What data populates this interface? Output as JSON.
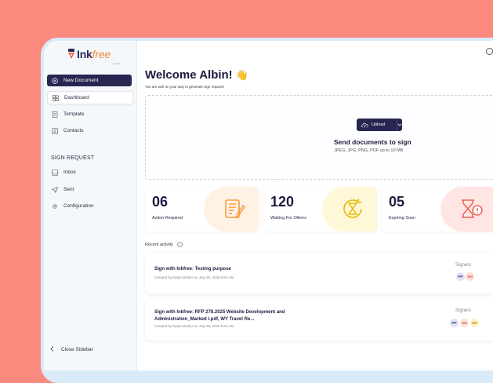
{
  "brand": {
    "name_part1": "Ink",
    "name_part2": "free",
    "sub": "by Sign"
  },
  "sidebar": {
    "new_document": "New Document",
    "items": [
      {
        "label": "Dashboard"
      },
      {
        "label": "Template"
      },
      {
        "label": "Contacts"
      }
    ],
    "section": "SIGN REQUEST",
    "request_items": [
      {
        "label": "Inbox"
      },
      {
        "label": "Sent"
      },
      {
        "label": "Configuration"
      }
    ],
    "close": "Close Sidebar"
  },
  "header": {
    "welcome": "Welcome Albin!",
    "wave": "👋",
    "subtitle": "You are well on your way to generate sign request!"
  },
  "upload": {
    "button": "Upload",
    "title": "Send documents to sign",
    "formats": "JPEG, JPG, PNG, PDF up to 10 MB"
  },
  "stats": [
    {
      "value": "06",
      "label": "Action Required",
      "color": "#fff1e3",
      "icon_color": "#f59a3a"
    },
    {
      "value": "120",
      "label": "Waiting For Others",
      "color": "#fff8d8",
      "icon_color": "#e6b800"
    },
    {
      "value": "05",
      "label": "Expiring Soon",
      "color": "#ffe6e4",
      "icon_color": "#f06257"
    }
  ],
  "recent": {
    "heading": "Recent activity",
    "items": [
      {
        "title": "Sign with Inkfree: Testing purpose",
        "meta": "Created by Deep Morker on July 29, 2025 6:04 AM",
        "signers_label": "Signers",
        "signers": [
          "PP",
          "SM"
        ]
      },
      {
        "title": "Sign with Inkfree: RFP 278.2025 Website Development and Administration_Marked I.pdf, WY Travel Re...",
        "meta": "Created by Deep Morker on July 29, 2025 6:04 AM",
        "signers_label": "Signers",
        "signers": [
          "PP",
          "SM",
          "MP"
        ]
      }
    ]
  }
}
